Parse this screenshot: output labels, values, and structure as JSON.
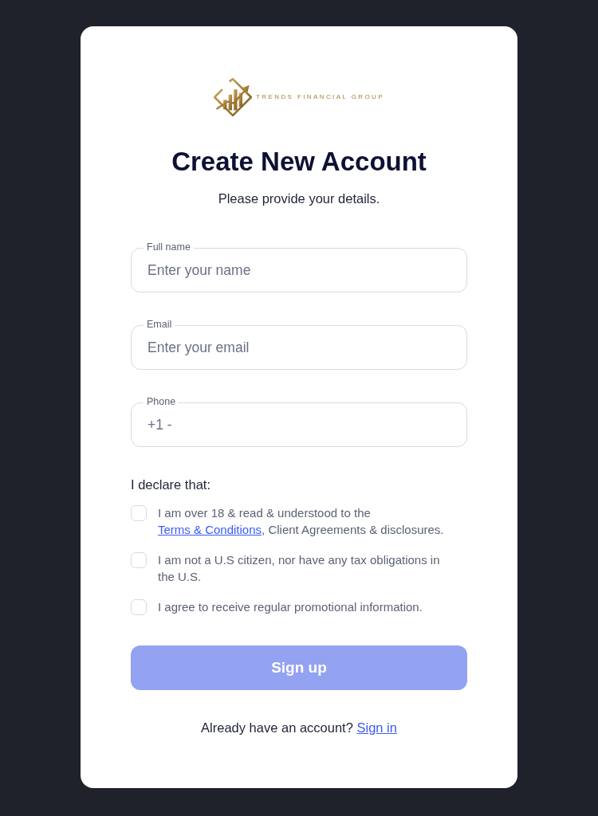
{
  "logo": {
    "text": "TRENDS FINANCIAL GROUP"
  },
  "heading": {
    "title": "Create New Account",
    "subtitle": "Please provide your details."
  },
  "fields": [
    {
      "label": "Full name",
      "placeholder": "Enter your name"
    },
    {
      "label": "Email",
      "placeholder": "Enter your email"
    },
    {
      "label": "Phone",
      "placeholder": "+1 -"
    }
  ],
  "declarations": {
    "title": "I declare that:",
    "items": [
      {
        "checked": false,
        "text": "I am over 18 & read & understood to the",
        "link": "Terms & Conditions",
        "text_after": ", Client Agreements & disclosures."
      },
      {
        "checked": false,
        "text": "I am not a U.S citizen, nor have any tax obligations in the U.S."
      },
      {
        "checked": false,
        "text": "I agree to receive regular promotional information."
      }
    ]
  },
  "signup_button": {
    "label": "Sign up",
    "disabled": true
  },
  "signin": {
    "prompt": "Already have an account?",
    "link": "Sign in"
  }
}
